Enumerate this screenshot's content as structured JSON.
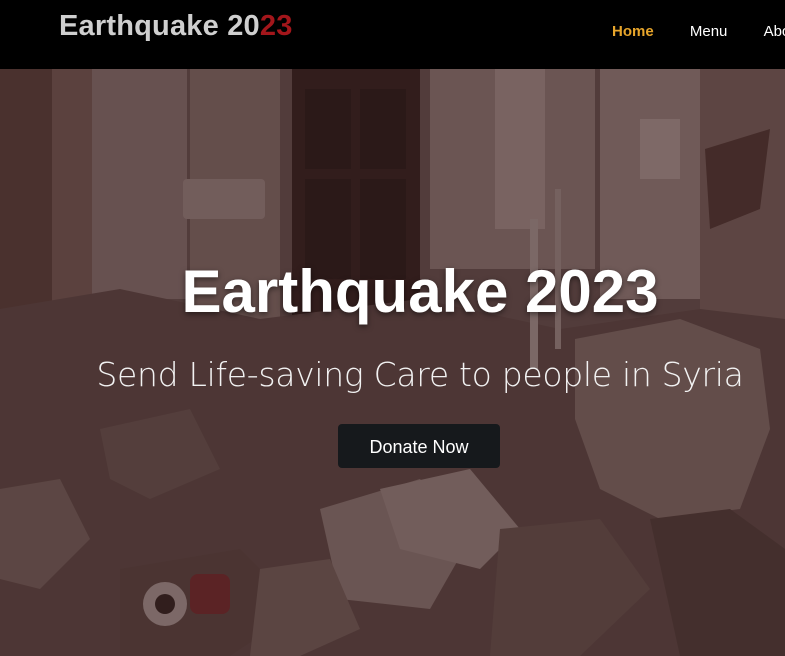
{
  "header": {
    "brand_main": "Earthquake 20",
    "brand_accent": "23",
    "nav": [
      {
        "label": "Home",
        "active": true
      },
      {
        "label": "Menu",
        "active": false
      },
      {
        "label": "Abo",
        "active": false
      }
    ]
  },
  "hero": {
    "title": "Earthquake 2023",
    "subtitle": "Send Life-saving Care to people in Syria",
    "cta_label": "Donate Now",
    "background": "rubble-photo"
  },
  "colors": {
    "nav_active": "#e7a52b",
    "brand_accent": "#a3161b",
    "button_bg": "#16191c",
    "navbar_bg": "#000000"
  }
}
